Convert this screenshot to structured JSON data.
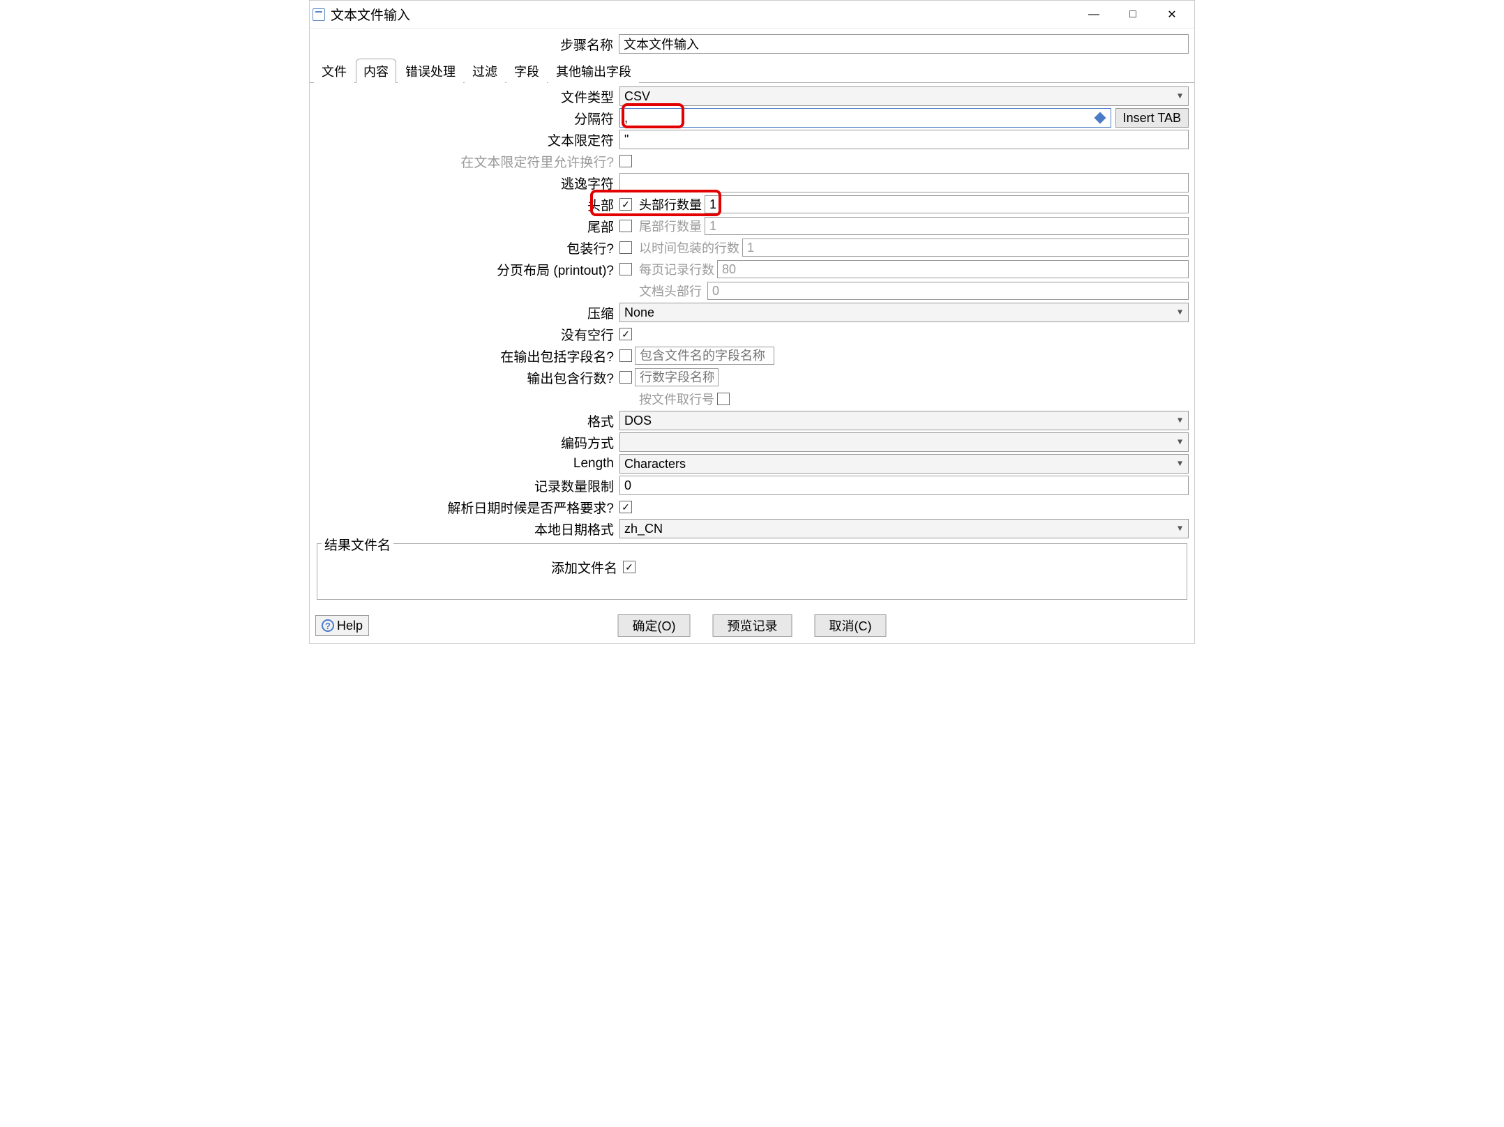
{
  "window": {
    "title": "文本文件输入",
    "minimize": "—",
    "maximize": "□",
    "close": "✕"
  },
  "step": {
    "label": "步骤名称",
    "value": "文本文件输入"
  },
  "tabs": {
    "file": "文件",
    "content": "内容",
    "error": "错误处理",
    "filter": "过滤",
    "fields": "字段",
    "other": "其他输出字段"
  },
  "form": {
    "filetype_label": "文件类型",
    "filetype_value": "CSV",
    "separator_label": "分隔符",
    "separator_value": ",",
    "insert_tab_btn": "Insert TAB",
    "textqual_label": "文本限定符",
    "textqual_value": "\"",
    "allow_newline_label": "在文本限定符里允许换行?",
    "escape_label": "逃逸字符",
    "escape_value": "",
    "header_label": "头部",
    "header_count_label": "头部行数量",
    "header_count_value": "1",
    "footer_label": "尾部",
    "footer_count_label": "尾部行数量",
    "footer_count_value": "1",
    "wrap_label": "包装行?",
    "wrap_count_label": "以时间包装的行数",
    "wrap_count_value": "1",
    "printout_label": "分页布局 (printout)?",
    "printout_count_label": "每页记录行数",
    "printout_count_value": "80",
    "doc_header_label": "文档头部行",
    "doc_header_value": "0",
    "compress_label": "压缩",
    "compress_value": "None",
    "noempty_label": "没有空行",
    "inc_filename_label": "在输出包括字段名?",
    "inc_filename_placeholder": "包含文件名的字段名称",
    "inc_rownum_label": "输出包含行数?",
    "inc_rownum_placeholder": "行数字段名称",
    "rownum_byfile_label": "按文件取行号",
    "format_label": "格式",
    "format_value": "DOS",
    "encoding_label": "编码方式",
    "encoding_value": "",
    "length_label": "Length",
    "length_value": "Characters",
    "limit_label": "记录数量限制",
    "limit_value": "0",
    "strict_date_label": "解析日期时候是否严格要求?",
    "locale_label": "本地日期格式",
    "locale_value": "zh_CN"
  },
  "result_group": {
    "legend": "结果文件名",
    "add_filename_label": "添加文件名"
  },
  "buttons": {
    "help": "Help",
    "ok": "确定(O)",
    "preview": "预览记录",
    "cancel": "取消(C)"
  }
}
